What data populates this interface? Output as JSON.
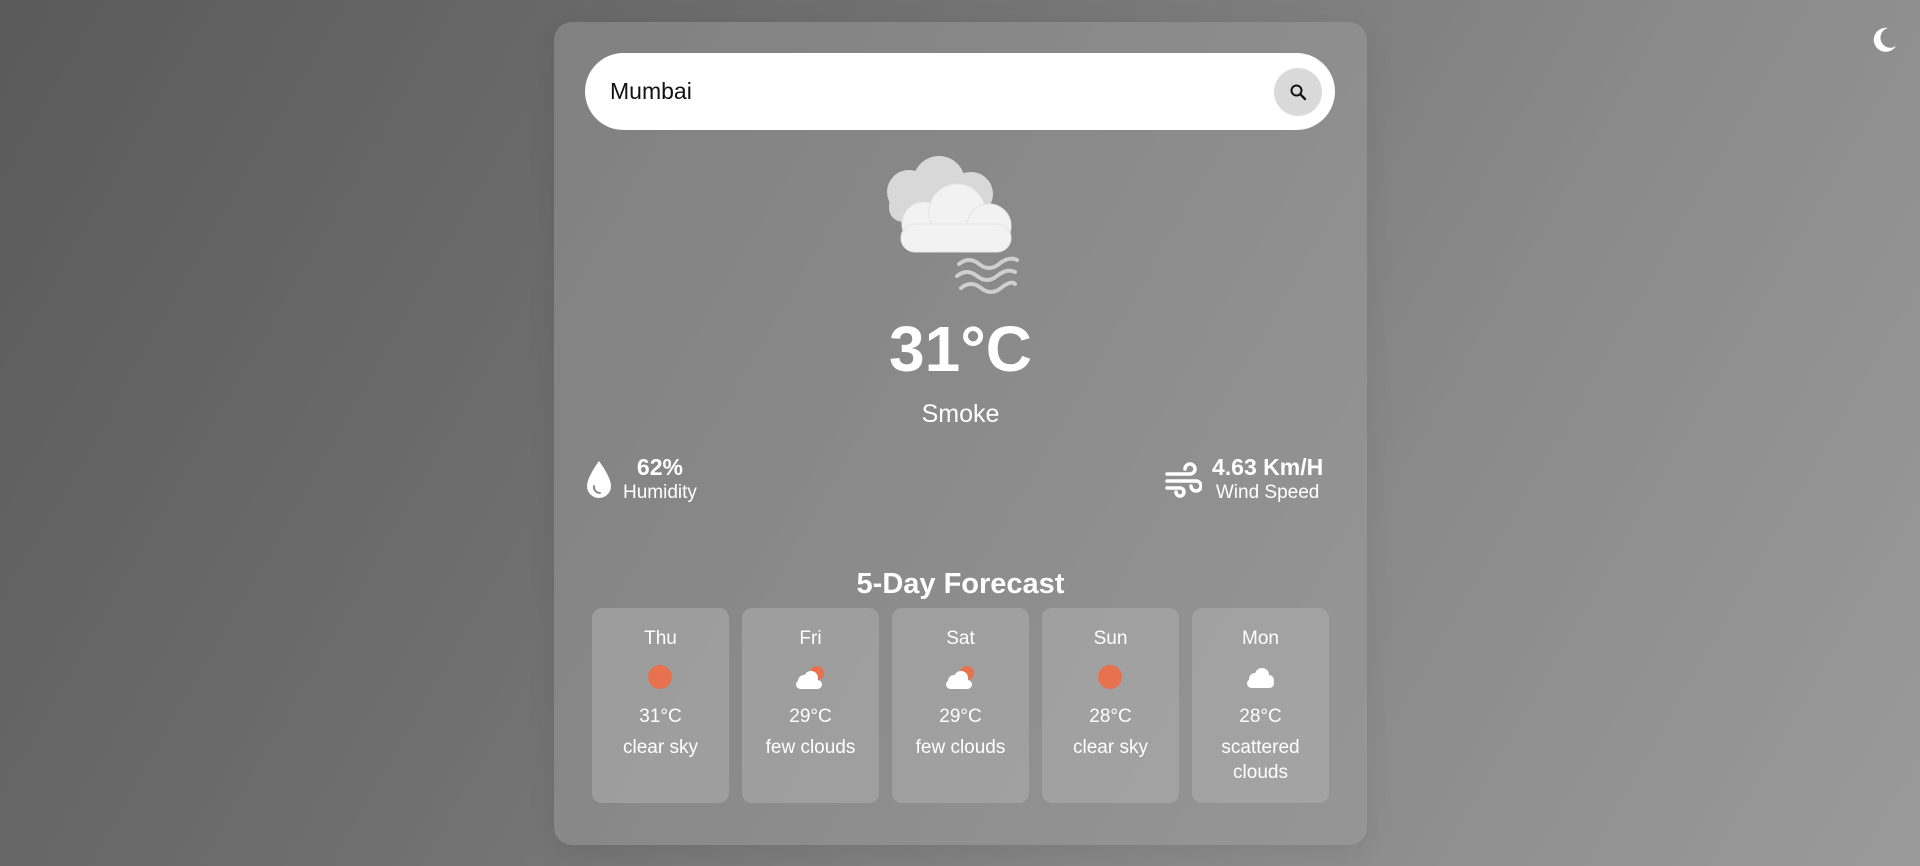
{
  "header": {
    "theme_toggle_icon": "moon-icon"
  },
  "search": {
    "value": "Mumbai",
    "button_icon": "search-icon"
  },
  "current": {
    "icon": "smoke-cloud-icon",
    "temperature": "31°C",
    "condition": "Smoke",
    "humidity": {
      "value": "62%",
      "label": "Humidity",
      "icon": "water-drop-icon"
    },
    "wind": {
      "value": "4.63 Km/H",
      "label": "Wind Speed",
      "icon": "wind-icon"
    }
  },
  "forecast": {
    "title": "5-Day Forecast",
    "days": [
      {
        "day": "Thu",
        "icon": "sun-icon",
        "temp": "31°C",
        "desc": "clear sky"
      },
      {
        "day": "Fri",
        "icon": "sun-cloud-icon",
        "temp": "29°C",
        "desc": "few clouds"
      },
      {
        "day": "Sat",
        "icon": "sun-cloud-icon",
        "temp": "29°C",
        "desc": "few clouds"
      },
      {
        "day": "Sun",
        "icon": "sun-icon",
        "temp": "28°C",
        "desc": "clear sky"
      },
      {
        "day": "Mon",
        "icon": "cloud-icon",
        "temp": "28°C",
        "desc": "scattered clouds"
      }
    ]
  },
  "colors": {
    "accent_sun": "#e8714f",
    "text": "#ffffff",
    "search_bg": "#ffffff"
  }
}
